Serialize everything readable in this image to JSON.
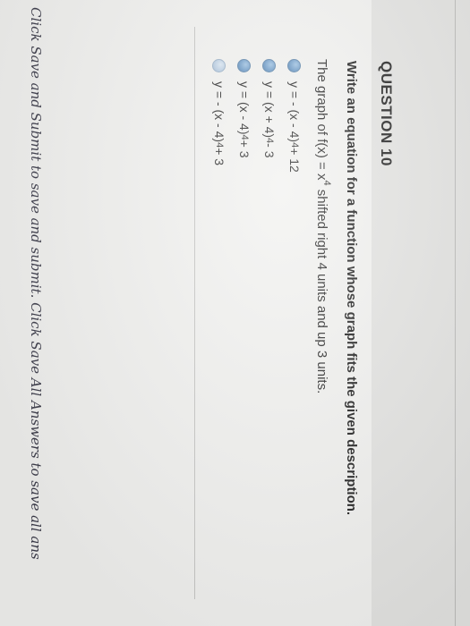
{
  "question": {
    "title": "QUESTION 10",
    "prompt": "Write an equation for a function whose graph fits the given description.",
    "stem": {
      "before": "The graph of f(x) = x",
      "exponent": "4",
      "after": " shifted right 4 units and up 3 units."
    },
    "choices": [
      {
        "before": "y = - (x - 4)",
        "exponent": "4",
        "after": " + 12",
        "radio_style": "blue"
      },
      {
        "before": "y = (x + 4)",
        "exponent": "4",
        "after": " - 3",
        "radio_style": "blue"
      },
      {
        "before": "y = (x - 4)",
        "exponent": "4",
        "after": " + 3",
        "radio_style": "blue"
      },
      {
        "before": "y = - (x - 4)",
        "exponent": "4",
        "after": " + 3",
        "radio_style": "light"
      }
    ]
  },
  "footer": {
    "text": "Click Save and Submit to save and submit. Click Save All Answers to save all ans"
  }
}
